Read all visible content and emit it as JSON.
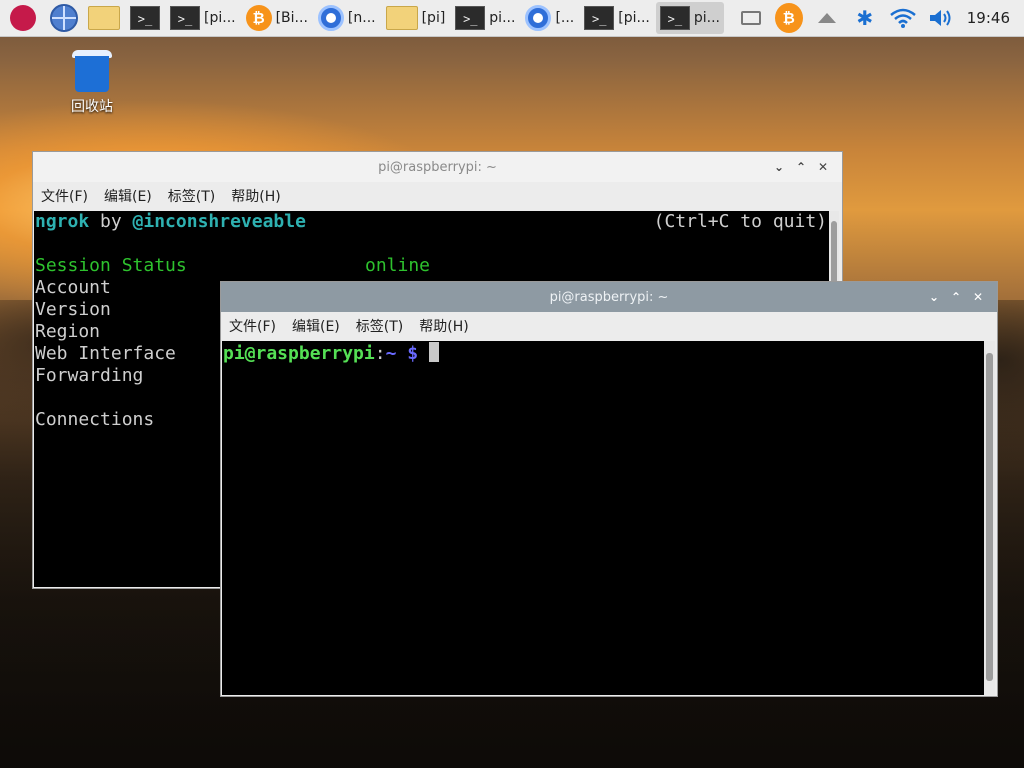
{
  "taskbar": {
    "tasks": [
      {
        "icon": "terminal-icon",
        "label": ""
      },
      {
        "icon": "terminal-icon",
        "label": "[pi..."
      },
      {
        "icon": "bitcoin-icon",
        "label": "[Bi..."
      },
      {
        "icon": "chromium-icon",
        "label": "[n..."
      },
      {
        "icon": "folder-icon",
        "label": "[pi]"
      },
      {
        "icon": "terminal-icon",
        "label": "pi..."
      },
      {
        "icon": "chromium-icon",
        "label": "[..."
      },
      {
        "icon": "terminal-icon",
        "label": "[pi..."
      },
      {
        "icon": "terminal-icon",
        "label": "pi..."
      }
    ],
    "clock": "19:46",
    "colors": {
      "bitcoin": "#f7931a",
      "bluetooth": "#1a6fd1",
      "wifi": "#1a6fd1"
    }
  },
  "desktop": {
    "trash_label": "回收站"
  },
  "back_window": {
    "title": "pi@raspberrypi: ~",
    "menu": [
      "文件(F)",
      "编辑(E)",
      "标签(T)",
      "帮助(H)"
    ],
    "header_left_1": "ngrok",
    "header_left_2": " by ",
    "header_left_3": "@inconshreveable",
    "header_right": "(Ctrl+C to quit)",
    "status_label": "Session Status",
    "status_value": "online",
    "rows": [
      "Account",
      "Version",
      "Region",
      "Web Interface",
      "Forwarding"
    ],
    "connections": "Connections"
  },
  "front_window": {
    "title": "pi@raspberrypi: ~",
    "menu": [
      "文件(F)",
      "编辑(E)",
      "标签(T)",
      "帮助(H)"
    ],
    "prompt_user": "pi@raspberrypi",
    "prompt_colon": ":",
    "prompt_path": "~",
    "prompt_sign": " $ "
  }
}
